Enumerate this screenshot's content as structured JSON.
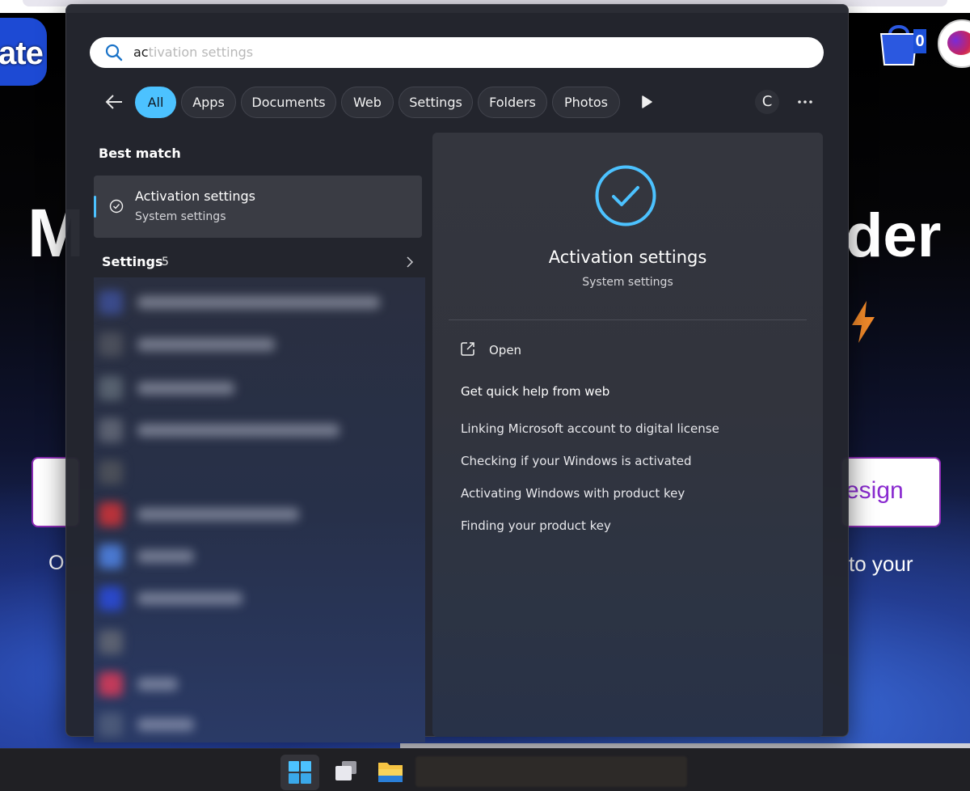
{
  "background_page": {
    "logo_text": "ate",
    "headline_left": "M",
    "headline_right": "der",
    "cart_count": "0",
    "button_right_text": "esign",
    "sub_left": "O",
    "sub_right": "to your"
  },
  "search": {
    "typed": "ac",
    "suggestion": "tivation settings"
  },
  "filters": {
    "items": [
      "All",
      "Apps",
      "Documents",
      "Web",
      "Settings",
      "Folders",
      "Photos"
    ],
    "active": "All",
    "user_initial": "C"
  },
  "results": {
    "best_match_heading": "Best match",
    "best_match": {
      "title": "Activation settings",
      "subtitle": "System settings"
    },
    "settings_heading": "Settings",
    "settings_count": "5"
  },
  "preview": {
    "title": "Activation settings",
    "subtitle": "System settings",
    "open_label": "Open",
    "help_heading": "Get quick help from web",
    "help_links": [
      "Linking Microsoft account to digital license",
      "Checking if your Windows is activated",
      "Activating Windows with product key",
      "Finding your product key"
    ]
  },
  "colors": {
    "accent": "#4cc2ff",
    "panel_bg": "#24262e",
    "taskbar_bg": "#202024"
  },
  "icons": {
    "search": "search-icon",
    "back": "back-arrow-icon",
    "play": "play-icon",
    "more": "more-icon",
    "check": "checkmark-circle-icon",
    "open": "open-external-icon",
    "chevron": "chevron-right-icon",
    "start": "windows-start-icon",
    "taskview": "task-view-icon",
    "explorer": "file-explorer-icon"
  }
}
